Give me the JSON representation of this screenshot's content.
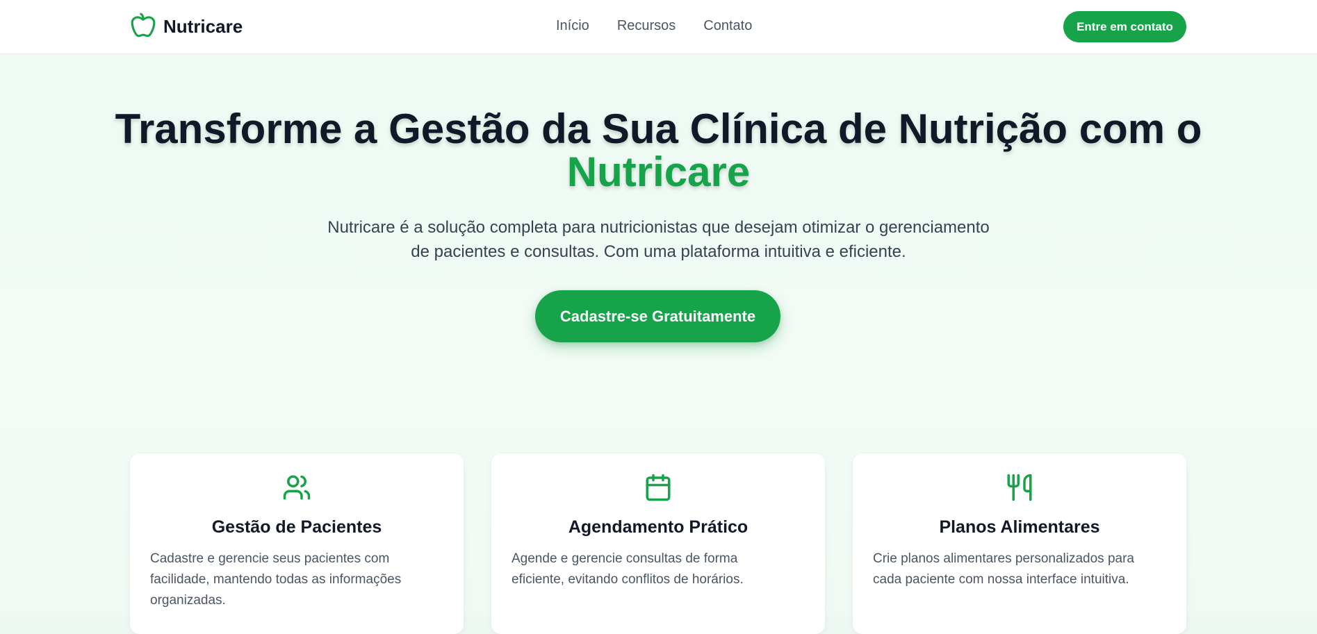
{
  "header": {
    "logo_text": "Nutricare",
    "logo_icon": "apple-icon",
    "nav": [
      {
        "label": "Início"
      },
      {
        "label": "Recursos"
      },
      {
        "label": "Contato"
      }
    ],
    "cta_label": "Entre em contato"
  },
  "hero": {
    "title_part1": "Transforme a Gestão da Sua Clínica de Nutrição com o ",
    "title_accent": "Nutricare",
    "subtitle": "Nutricare é a solução completa para nutricionistas que desejam otimizar o gerenciamento de pacientes e consultas. Com uma plataforma intuitiva e eficiente.",
    "cta_label": "Cadastre-se Gratuitamente"
  },
  "features": [
    {
      "icon": "users-icon",
      "title": "Gestão de Pacientes",
      "description": "Cadastre e gerencie seus pacientes com facilidade, mantendo todas as informações organizadas."
    },
    {
      "icon": "calendar-icon",
      "title": "Agendamento Prático",
      "description": "Agende e gerencie consultas de forma eficiente, evitando conflitos de horários."
    },
    {
      "icon": "utensils-icon",
      "title": "Planos Alimentares",
      "description": "Crie planos alimentares personalizados para cada paciente com nossa interface intuitiva."
    }
  ],
  "colors": {
    "brand": "#16a34a",
    "text_dark": "#111827",
    "text_muted": "#4b5563",
    "hero_bg": "#eefaf3"
  }
}
